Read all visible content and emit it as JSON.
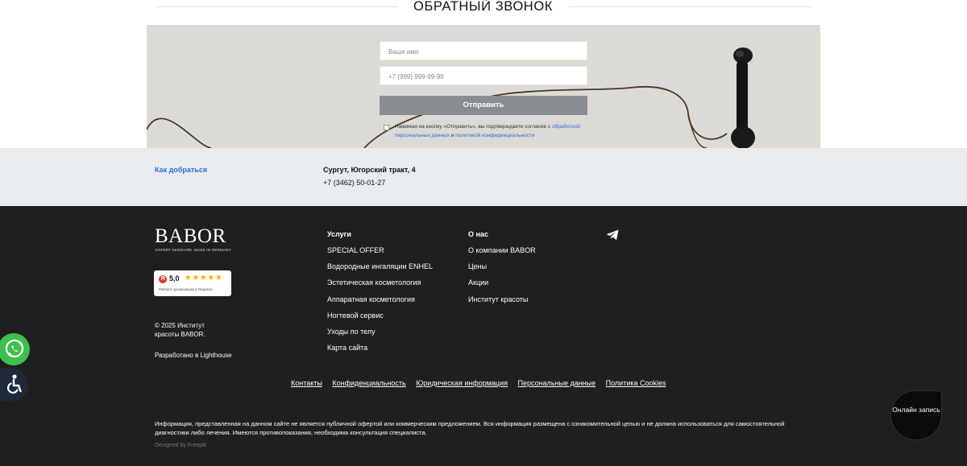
{
  "callback": {
    "title": "ОБРАТНЫЙ ЗВОНОК",
    "name_placeholder": "Ваше имя",
    "phone_placeholder": "+7 (999) 999-99-99",
    "submit_label": "Отправить",
    "consent_text": "Нажимая на кнопку «Отправить», вы подтверждаете согласие с ",
    "consent_link1": "обработкой персональных данных",
    "consent_and": " и ",
    "consent_link2": "политикой конфиденциальности"
  },
  "location": {
    "how_to_get": "Как добраться",
    "address": "Сургут, Югорский тракт, 4",
    "phone": "+7 (3462) 50-01-27"
  },
  "footer": {
    "logo": "BABOR",
    "logo_tagline": "EXPERT SKINCARE. MADE IN GERMANY.",
    "rating": {
      "score": "5,0",
      "stars": "★★★★★",
      "label": "Рейтинг организации в Яндексе",
      "badge": "Я"
    },
    "copyright": "© 2025 Институт красоты BABOR.",
    "developed": "Разработано в Lighthouse",
    "services": {
      "heading": "Услуги",
      "items": [
        "SPECIAL OFFER",
        "Водородные ингаляции ENHEL",
        "Эстетическая косметология",
        "Аппаратная косметология",
        "Ногтевой сервис",
        "Уходы по телу",
        "Карта сайта"
      ]
    },
    "about": {
      "heading": "О нас",
      "items": [
        "О компании BABOR",
        "Цены",
        "Акции",
        "Институт красоты"
      ]
    },
    "legal_links": [
      "Контакты",
      "Конфиденциальность",
      "Юридическая информация",
      "Персональные данные",
      "Политика Cookies"
    ],
    "disclaimer": "Информация, представленная на данном сайте не является публичной офертой или коммерческим предложением. Вся информация размещена с ознакомительной целью и не должна использоваться для самостоятельной диагностики либо лечения. Имеются противопоказания, необходима консультация специалиста.",
    "designed_by": "Designed by Freepik"
  },
  "widgets": {
    "online_booking": "Онлайн запись"
  },
  "colors": {
    "link_blue": "#2e6ed1",
    "footer_bg": "#1f1f20",
    "whatsapp_green": "#3fbf4f",
    "button_gray": "#8a8d90",
    "star_yellow": "#f5b400"
  }
}
